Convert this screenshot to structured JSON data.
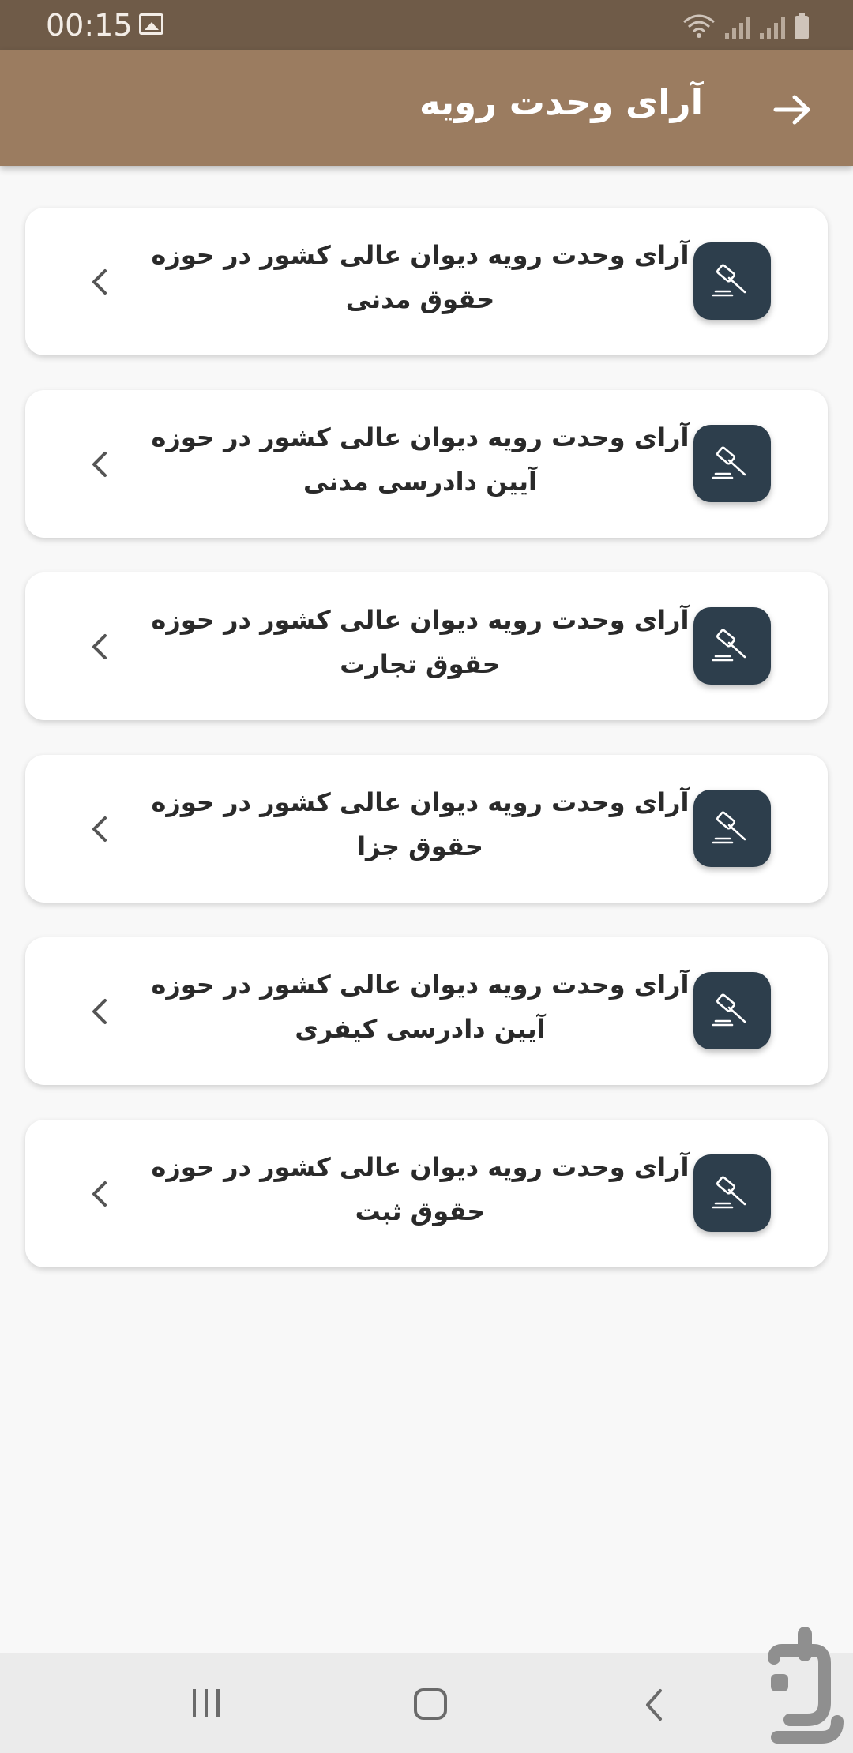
{
  "status": {
    "time": "00:15",
    "icons": [
      "gallery-icon",
      "wifi-icon",
      "signal-icon",
      "signal-icon",
      "battery-icon"
    ]
  },
  "app_bar": {
    "title": "آرای وحدت رویه",
    "back_icon": "arrow-right-icon",
    "background_color": "#9b7c60"
  },
  "items": [
    {
      "line1": "آرای وحدت رویه دیوان عالی کشور در حوزه",
      "line2": "حقوق مدنی",
      "icon": "gavel-icon"
    },
    {
      "line1": "آرای وحدت رویه دیوان عالی کشور در حوزه",
      "line2": "آیین دادرسی مدنی",
      "icon": "gavel-icon"
    },
    {
      "line1": "آرای وحدت رویه دیوان عالی کشور در حوزه",
      "line2": "حقوق تجارت",
      "icon": "gavel-icon"
    },
    {
      "line1": "آرای وحدت رویه دیوان عالی کشور در حوزه",
      "line2": "حقوق جزا",
      "icon": "gavel-icon"
    },
    {
      "line1": "آرای وحدت رویه دیوان عالی کشور در حوزه",
      "line2": "آیین دادرسی کیفری",
      "icon": "gavel-icon"
    },
    {
      "line1": "آرای وحدت رویه دیوان عالی کشور در حوزه",
      "line2": "حقوق ثبت",
      "icon": "gavel-icon"
    }
  ],
  "colors": {
    "status_bar": "#6f5b48",
    "icon_tile": "#2d3e4c",
    "card": "#ffffff",
    "background": "#f8f8f8"
  },
  "nav": {
    "icons": [
      "recent-apps-icon",
      "home-icon",
      "back-icon"
    ]
  }
}
